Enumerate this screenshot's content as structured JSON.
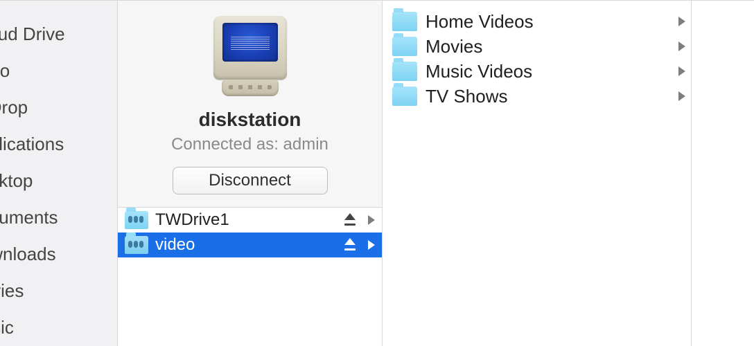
{
  "sidebar": {
    "items": [
      {
        "label": "iCloud Drive"
      },
      {
        "label": "Undo"
      },
      {
        "label": "AirDrop"
      },
      {
        "label": "Applications"
      },
      {
        "label": "Desktop"
      },
      {
        "label": "Documents"
      },
      {
        "label": "Downloads"
      },
      {
        "label": "Movies"
      },
      {
        "label": "Music"
      }
    ]
  },
  "server": {
    "name": "diskstation",
    "status": "Connected as: admin",
    "disconnect_label": "Disconnect",
    "shares": [
      {
        "label": "TWDrive1",
        "selected": false
      },
      {
        "label": "video",
        "selected": true
      }
    ]
  },
  "folders": {
    "items": [
      {
        "label": "Home Videos"
      },
      {
        "label": "Movies"
      },
      {
        "label": "Music Videos"
      },
      {
        "label": "TV Shows"
      }
    ]
  },
  "colors": {
    "selection": "#1a6fe8",
    "folder": "#7dd3f3",
    "sidebar_bg": "#f1f0f2"
  }
}
